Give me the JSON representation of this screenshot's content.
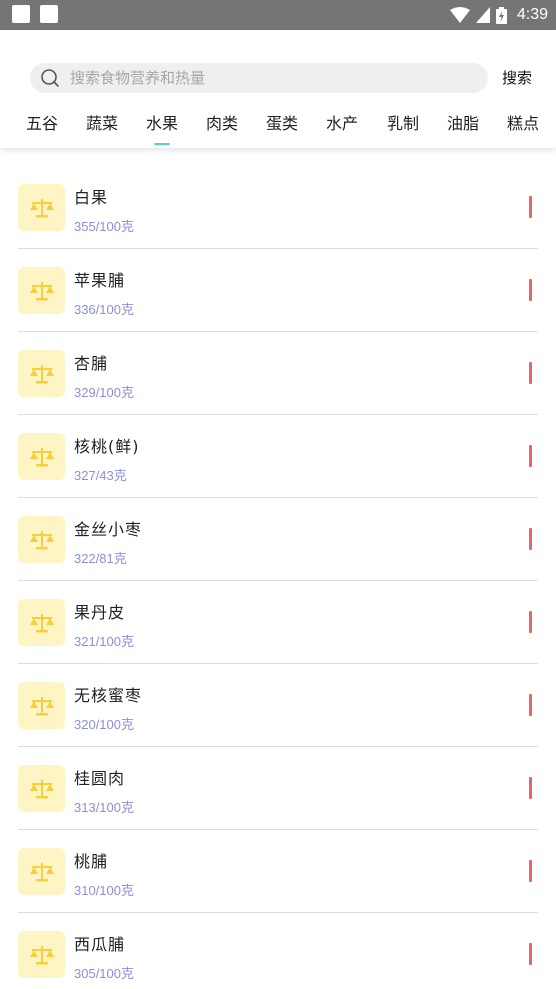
{
  "status_bar": {
    "time": "4:39",
    "icons": [
      "square-icon",
      "square-icon",
      "wifi-icon",
      "signal-icon",
      "battery-icon"
    ]
  },
  "search": {
    "placeholder": "搜索食物营养和热量",
    "value": "",
    "button_label": "搜索"
  },
  "tabs": [
    {
      "label": "五谷"
    },
    {
      "label": "蔬菜"
    },
    {
      "label": "水果",
      "active": true
    },
    {
      "label": "肉类"
    },
    {
      "label": "蛋类"
    },
    {
      "label": "水产"
    },
    {
      "label": "乳制"
    },
    {
      "label": "油脂"
    },
    {
      "label": "糕点"
    }
  ],
  "foods": [
    {
      "name": "白果",
      "calorie": "355/100克"
    },
    {
      "name": "苹果脯",
      "calorie": "336/100克"
    },
    {
      "name": "杏脯",
      "calorie": "329/100克"
    },
    {
      "name": "核桃(鲜)",
      "calorie": "327/43克"
    },
    {
      "name": "金丝小枣",
      "calorie": "322/81克"
    },
    {
      "name": "果丹皮",
      "calorie": "321/100克"
    },
    {
      "name": "无核蜜枣",
      "calorie": "320/100克"
    },
    {
      "name": "桂圆肉",
      "calorie": "313/100克"
    },
    {
      "name": "桃脯",
      "calorie": "310/100克"
    },
    {
      "name": "西瓜脯",
      "calorie": "305/100克"
    }
  ],
  "colors": {
    "status_bar": "#757575",
    "tab_indicator": "#4fd3cf",
    "icon_bg": "#fff4c4",
    "icon_fg": "#f7cf3a",
    "calorie_text": "#8b8fd8",
    "level_bar": "#e5646a"
  }
}
